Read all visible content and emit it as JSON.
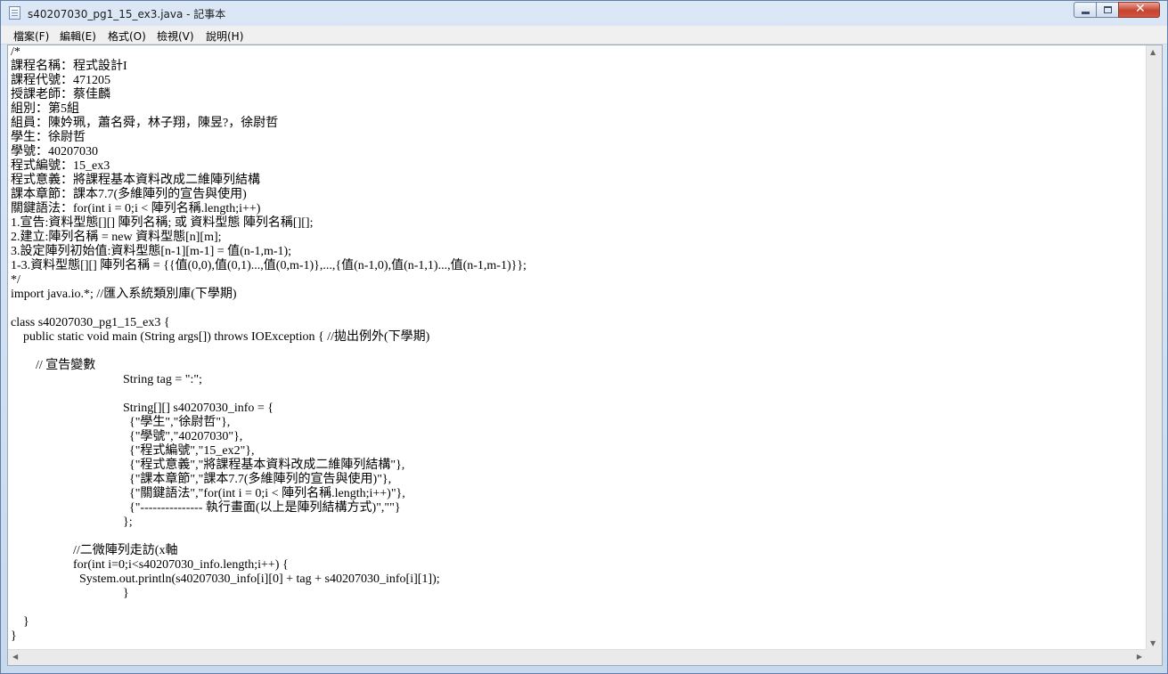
{
  "window": {
    "title": "s40207030_pg1_15_ex3.java - 記事本"
  },
  "menu": {
    "file": "檔案(F)",
    "edit": "編輯(E)",
    "format": "格式(O)",
    "view": "檢視(V)",
    "help": "說明(H)"
  },
  "editor": {
    "content": "/*\n課程名稱：程式設計I\n課程代號：471205\n授課老師：蔡佳麟\n組別：第5組\n組員：陳妗珮，蕭名舜，林子翔，陳昱?，徐尉哲\n學生：徐尉哲\n學號：40207030\n程式編號：15_ex3\n程式意義：將課程基本資料改成二維陣列結構\n課本章節：課本7.7(多維陣列的宣告與使用)\n關鍵語法：for(int i = 0;i < 陣列名稱.length;i++)\n1.宣告:資料型態[][] 陣列名稱; 或 資料型態 陣列名稱[][];\n2.建立:陣列名稱 = new 資料型態[n][m];\n3.設定陣列初始值:資料型態[n-1][m-1] = 值(n-1,m-1);\n1-3.資料型態[][] 陣列名稱 = {{值(0,0),值(0,1)...,值(0,m-1)},...,{值(n-1,0),值(n-1,1)...,值(n-1,m-1)}};\n*/\nimport java.io.*; //匯入系統類別庫(下學期)\n\nclass s40207030_pg1_15_ex3 {\n    public static void main (String args[]) throws IOException { //拋出例外(下學期)\n\n        // 宣告變數\n                                    String tag = \":\";\n\n                                    String[][] s40207030_info = {\n                                      {\"學生\",\"徐尉哲\"},\n                                      {\"學號\",\"40207030\"},\n                                      {\"程式編號\",\"15_ex2\"},\n                                      {\"程式意義\",\"將課程基本資料改成二維陣列結構\"},\n                                      {\"課本章節\",\"課本7.7(多維陣列的宣告與使用)\"},\n                                      {\"關鍵語法\",\"for(int i = 0;i < 陣列名稱.length;i++)\"},\n                                      {\"--------------- 執行畫面(以上是陣列結構方式)\",\"\"}\n                                    };\n\n                    //二微陣列走訪(x軸\n                    for(int i=0;i<s40207030_info.length;i++) {\n                      System.out.println(s40207030_info[i][0] + tag + s40207030_info[i][1]);\n                                    }\n\n    }\n}"
  }
}
